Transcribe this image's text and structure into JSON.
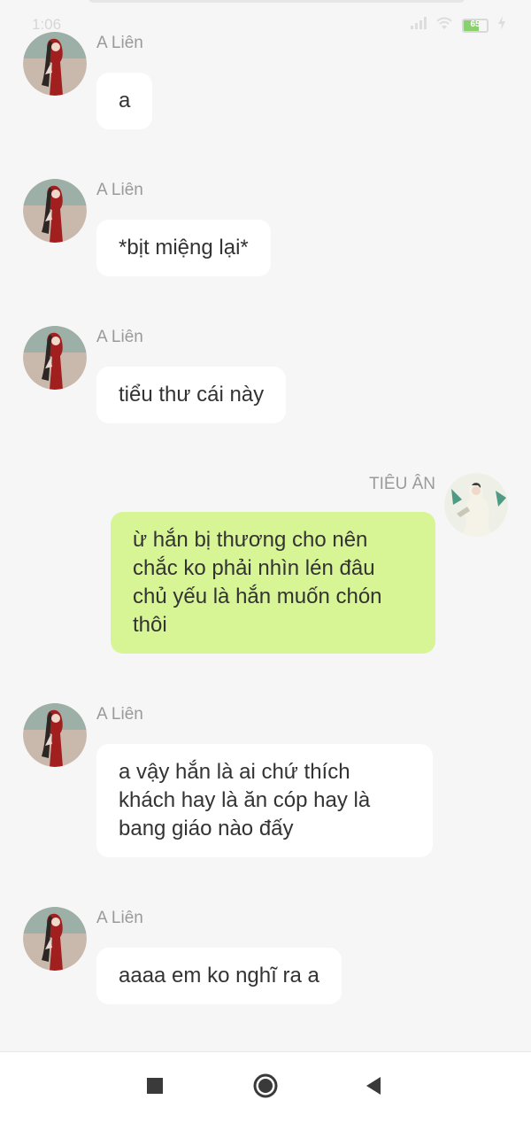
{
  "status_bar": {
    "time": "1:06",
    "battery_level": 0.65,
    "battery_text": "65",
    "icons": [
      "alarm-icon",
      "signal-icon",
      "wifi-icon",
      "battery-icon",
      "charging-icon"
    ]
  },
  "messages": [
    {
      "sender": "A Liên",
      "text": "a",
      "side": "left"
    },
    {
      "sender": "A Liên",
      "text": "*bịt miệng lại*",
      "side": "left"
    },
    {
      "sender": "A Liên",
      "text": "tiểu thư cái này",
      "side": "left"
    },
    {
      "sender": "TIÊU ÂN",
      "text": "ừ hắn bị thương cho nên chắc ko phải nhìn lén đâu chủ yếu là hắn muốn chón thôi",
      "side": "right"
    },
    {
      "sender": "A Liên",
      "text": "a vậy hắn là ai chứ thích khách hay là ăn cóp hay là bang giáo nào đấy",
      "side": "left"
    },
    {
      "sender": "A Liên",
      "text": "aaaa em ko nghĩ ra a",
      "side": "left"
    }
  ],
  "nav": {
    "recent": "square-icon",
    "home": "circle-icon",
    "back": "triangle-back-icon"
  },
  "colors": {
    "background": "#f6f6f6",
    "incoming_bubble": "#ffffff",
    "outgoing_bubble": "#d7f595",
    "name_text": "#9a9a9a",
    "message_text": "#333333",
    "nav_icon": "#3a3a3a"
  }
}
